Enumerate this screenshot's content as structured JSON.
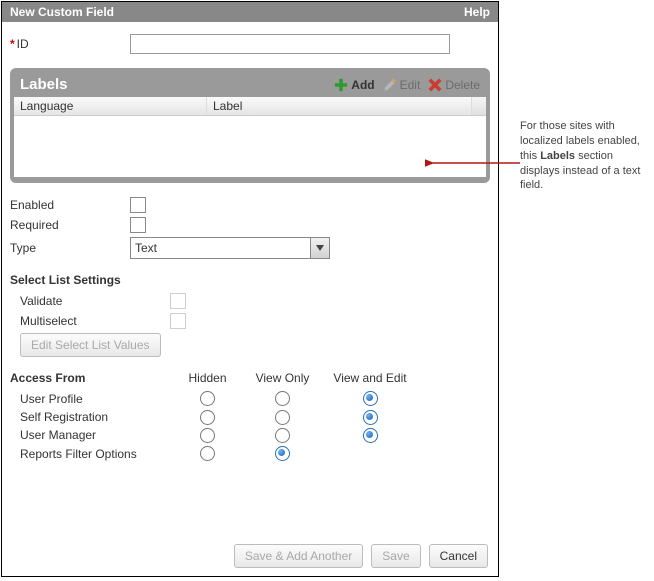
{
  "titlebar": {
    "title": "New Custom Field",
    "help": "Help"
  },
  "id": {
    "required_mark": "*",
    "label": "ID",
    "value": ""
  },
  "labelsPanel": {
    "title": "Labels",
    "actions": {
      "add": "Add",
      "edit": "Edit",
      "delete": "Delete"
    },
    "columns": {
      "language": "Language",
      "label": "Label"
    }
  },
  "toggles": {
    "enabled": "Enabled",
    "required": "Required"
  },
  "type": {
    "label": "Type",
    "value": "Text"
  },
  "selectList": {
    "heading": "Select List Settings",
    "validate": "Validate",
    "multiselect": "Multiselect",
    "editBtn": "Edit Select List Values"
  },
  "access": {
    "heading": "Access From",
    "cols": [
      "Hidden",
      "View Only",
      "View and Edit"
    ],
    "rows": [
      "User Profile",
      "Self Registration",
      "User Manager",
      "Reports Filter Options"
    ]
  },
  "buttons": {
    "saveAnother": "Save & Add Another",
    "save": "Save",
    "cancel": "Cancel"
  },
  "callout": {
    "t1": "For those sites with localized labels enabled, this ",
    "bold": "Labels",
    "t2": " section displays instead of a text field."
  }
}
